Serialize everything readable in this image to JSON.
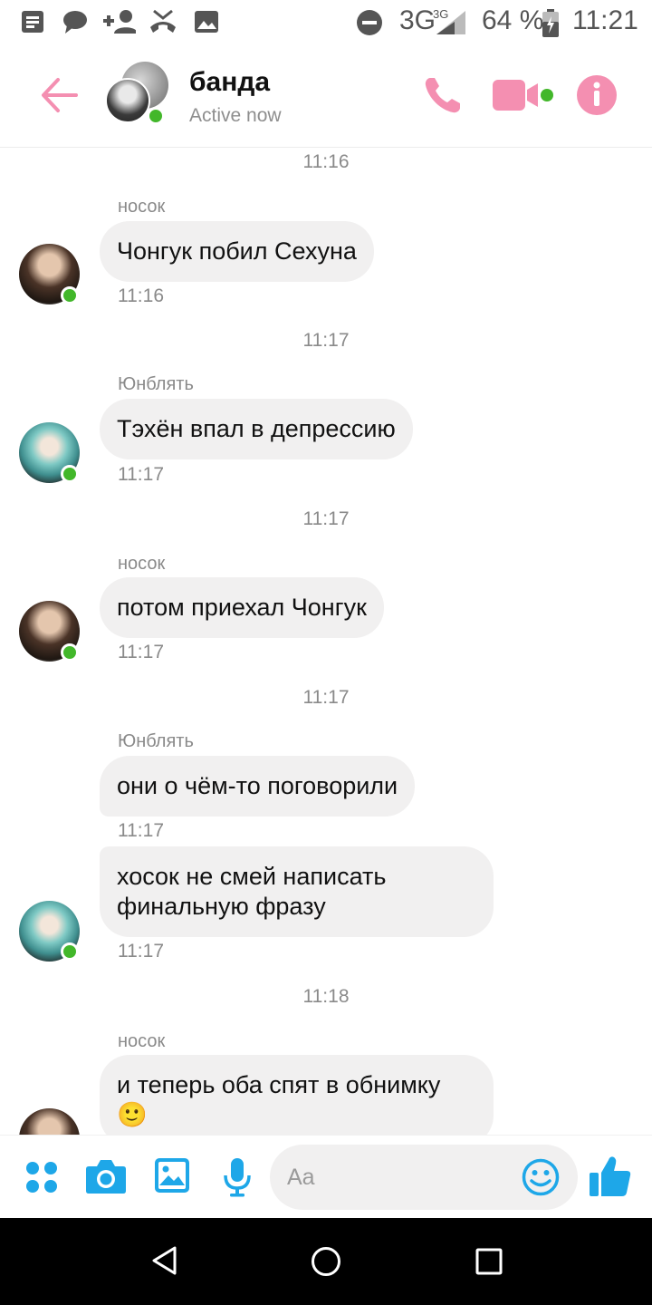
{
  "status_bar": {
    "network": "3G",
    "network_small": "3G",
    "battery": "64 %",
    "time": "11:21",
    "icons": [
      "notification-doc-icon",
      "chat-icon",
      "add-contact-icon",
      "missed-call-icon",
      "image-icon",
      "dnd-icon",
      "signal-icon",
      "battery-icon"
    ]
  },
  "header": {
    "title": "банда",
    "subtitle": "Active now",
    "accent": "#f48fb1",
    "icons": [
      "back-arrow-icon",
      "phone-icon",
      "video-call-icon",
      "info-icon"
    ]
  },
  "messages": [
    {
      "type": "timestamp",
      "text": "11:16"
    },
    {
      "type": "message",
      "sender": "носок",
      "text": "Чонгук побил Сехуна",
      "time": "11:16"
    },
    {
      "type": "timestamp",
      "text": "11:17"
    },
    {
      "type": "message",
      "sender": "Юнблять",
      "text": "Тэхён впал в депрессию",
      "time": "11:17"
    },
    {
      "type": "timestamp",
      "text": "11:17"
    },
    {
      "type": "message",
      "sender": "носок",
      "text": "потом приехал Чонгук",
      "time": "11:17"
    },
    {
      "type": "timestamp",
      "text": "11:17"
    },
    {
      "type": "message",
      "sender": "Юнблять",
      "text": "они о чём-то поговорили",
      "time": "11:17"
    },
    {
      "type": "message",
      "sender": "Юнблять",
      "text_line1": "хосок не смей написать",
      "text_line2": "финальную фразу",
      "time": "11:17"
    },
    {
      "type": "timestamp",
      "text": "11:18"
    },
    {
      "type": "message",
      "sender": "носок",
      "text_line1": "и теперь оба спят в обнимку",
      "text_line2": "🙂"
    }
  ],
  "composer": {
    "placeholder": "Aa",
    "icon_color": "#1ea7e8",
    "icons": [
      "more-apps-icon",
      "camera-icon",
      "gallery-icon",
      "microphone-icon",
      "emoji-icon",
      "thumbs-up-icon"
    ]
  },
  "nav_bar": {
    "icons": [
      "back-triangle-icon",
      "home-circle-icon",
      "recents-square-icon"
    ]
  }
}
